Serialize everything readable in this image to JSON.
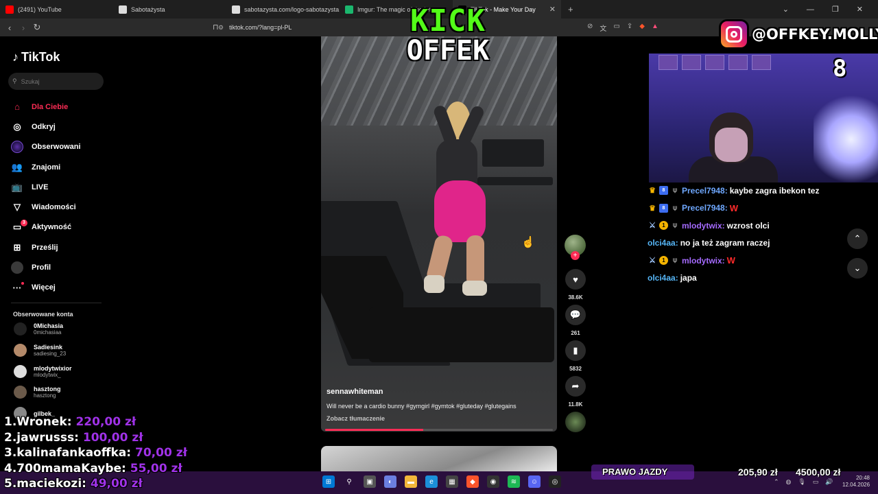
{
  "browser": {
    "tabs": [
      {
        "label": "(2491) YouTube",
        "color": "#ff0000",
        "active": false
      },
      {
        "label": "Sabotażysta",
        "color": "#dddddd",
        "active": false
      },
      {
        "label": "sabotazysta.com/logo-sabotazysta.s",
        "color": "#dddddd",
        "active": false
      },
      {
        "label": "Imgur: The magic of the Internet",
        "color": "#1bb76e",
        "active": false
      },
      {
        "label": "TikTok - Make Your Day",
        "color": "#000000",
        "active": true
      }
    ],
    "new_tab": "+",
    "url": "tiktok.com/?lang=pl-PL"
  },
  "tiktok": {
    "brand": "TikTok",
    "search_placeholder": "Szukaj",
    "menu": [
      {
        "label": "Dla Ciebie",
        "icon": "home-icon",
        "glyph": "⌂",
        "active": true
      },
      {
        "label": "Odkryj",
        "icon": "compass-icon",
        "glyph": "◎"
      },
      {
        "label": "Obserwowani",
        "icon": "following-avatar-icon",
        "glyph": ""
      },
      {
        "label": "Znajomi",
        "icon": "friends-icon",
        "glyph": "👥"
      },
      {
        "label": "LIVE",
        "icon": "live-tv-icon",
        "glyph": "📺"
      },
      {
        "label": "Wiadomości",
        "icon": "messages-icon",
        "glyph": "▽"
      },
      {
        "label": "Aktywność",
        "icon": "activity-icon",
        "glyph": "▭",
        "badge": "3"
      },
      {
        "label": "Prześlij",
        "icon": "upload-icon",
        "glyph": "⊞"
      },
      {
        "label": "Profil",
        "icon": "profile-avatar-icon",
        "glyph": ""
      },
      {
        "label": "Więcej",
        "icon": "more-icon",
        "glyph": "···",
        "dot": true
      }
    ],
    "followed_title": "Obserwowane konta",
    "followed": [
      {
        "name": "0Michasia",
        "handle": "0michasiaa",
        "color": "#222222"
      },
      {
        "name": "Sadiesink",
        "handle": "sadiesing_23",
        "color": "#b48a6a"
      },
      {
        "name": "mlodytwixior",
        "handle": "mlodytwix_",
        "color": "#dddddd"
      },
      {
        "name": "hasztong",
        "handle": "hasztong",
        "color": "#6b5a4a"
      },
      {
        "name": "gilbek_",
        "handle": "",
        "color": "#888888"
      }
    ]
  },
  "video": {
    "user": "sennawhiteman",
    "description": "Will never be a cardio bunny #gymgirl #gymtok #gluteday #glutegains",
    "translate": "Zobacz tłumaczenie",
    "progress": 0.43,
    "likes": "38.6K",
    "comments": "261",
    "saves": "5832",
    "shares": "11.8K"
  },
  "overlay": {
    "kick_line1": "KICK",
    "kick_line2": "OFFEK",
    "instagram_handle": "@OFFKEY.MOLLY",
    "cam_timer": "8"
  },
  "chat": [
    {
      "badges": [
        "crown",
        "gb",
        "u"
      ],
      "user": "Precel7948:",
      "user_class": "nm-blue",
      "text": "kaybe zagra ibekon tez",
      "text_class": ""
    },
    {
      "badges": [
        "crown",
        "gb",
        "u"
      ],
      "user": "Precel7948:",
      "user_class": "nm-blue",
      "text": "W",
      "text_class": "red"
    },
    {
      "badges": [
        "sword",
        "one",
        "u"
      ],
      "user": "mlodytwix:",
      "user_class": "nm-purple",
      "text": "wzrost olci",
      "text_class": ""
    },
    {
      "badges": [],
      "user": "olci4aa:",
      "user_class": "nm-teal",
      "text": "no ja też zagram raczej",
      "text_class": ""
    },
    {
      "badges": [
        "sword",
        "one",
        "u"
      ],
      "user": "mlodytwix:",
      "user_class": "nm-purple",
      "text": "W",
      "text_class": "red"
    },
    {
      "badges": [],
      "user": "olci4aa:",
      "user_class": "nm-teal",
      "text": "japa",
      "text_class": ""
    }
  ],
  "leaderboard": [
    {
      "rank_name": "1.Wronek:",
      "amount": "220,00 zł"
    },
    {
      "rank_name": "2.jawrusss:",
      "amount": "100,00 zł"
    },
    {
      "rank_name": "3.kalinafankaoffka:",
      "amount": "70,00 zł"
    },
    {
      "rank_name": "4.700mamaKaybe:",
      "amount": "55,00 zł"
    },
    {
      "rank_name": "5.maciekozi:",
      "amount": "49,00 zł"
    }
  ],
  "goal": {
    "label": "PRAWO JAZDY",
    "current": "205,90 zł",
    "target": "4500,00 zł"
  },
  "clock": {
    "time": "20:48",
    "date": "12.04.2026"
  }
}
